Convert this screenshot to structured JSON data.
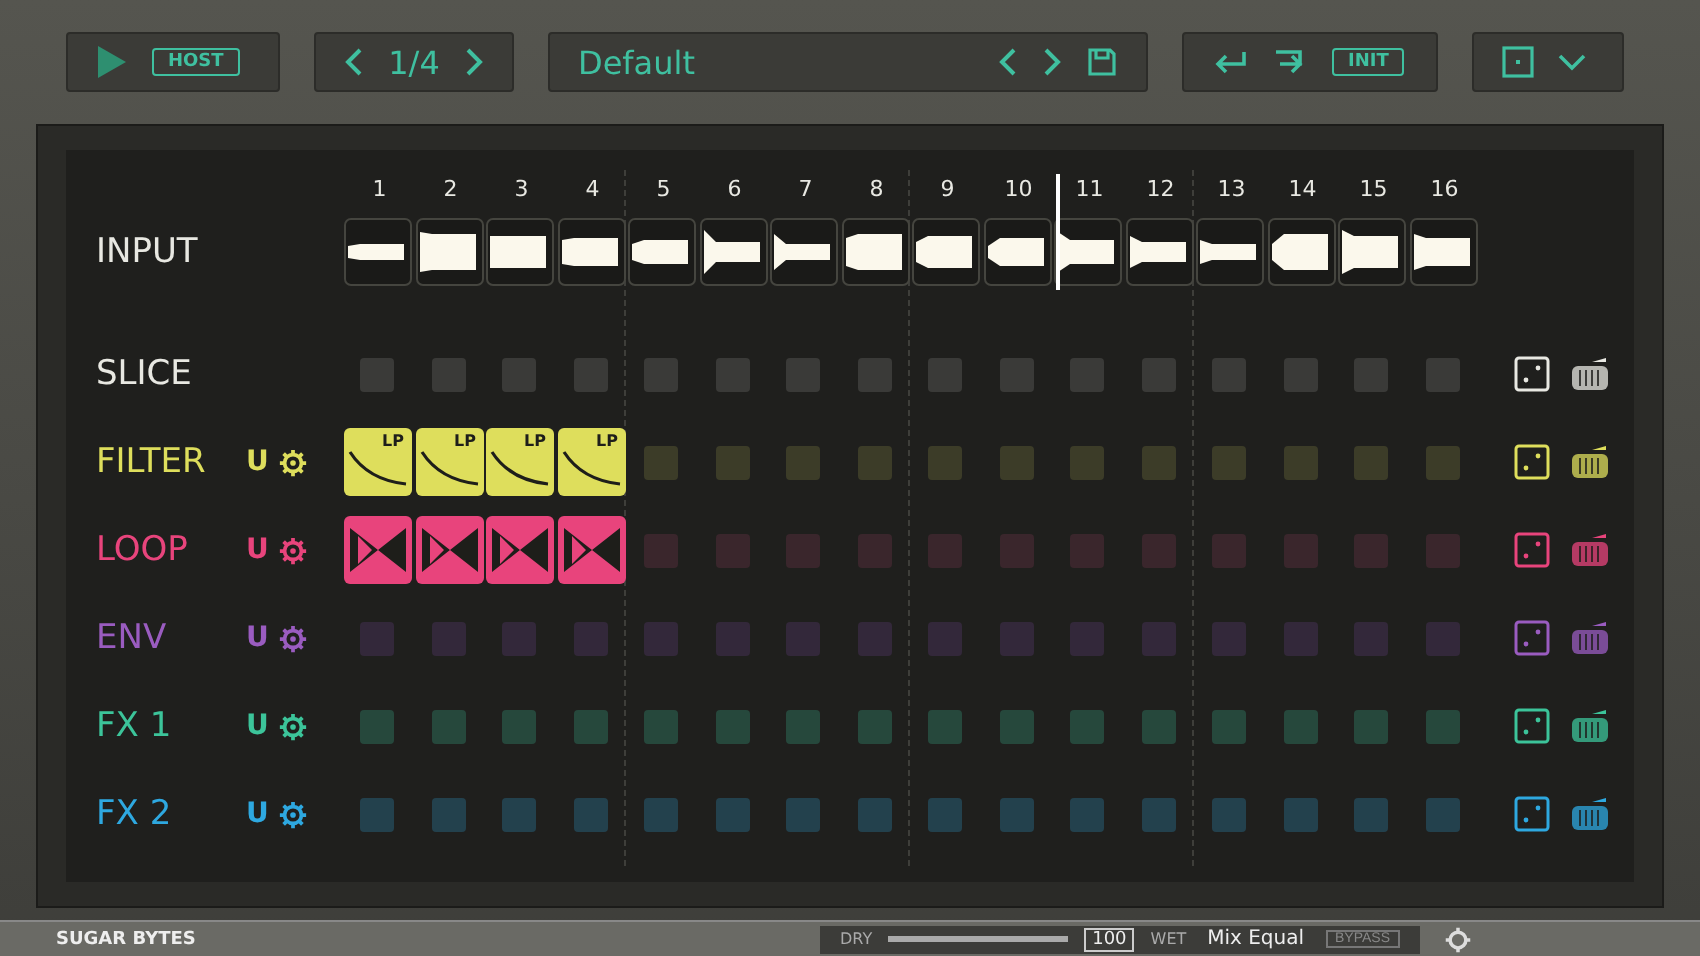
{
  "toolbar": {
    "host": "HOST",
    "page": "1/4",
    "preset": "Default",
    "init": "INIT"
  },
  "columns": [
    {
      "label": "1",
      "selected": false
    },
    {
      "label": "2",
      "selected": false
    },
    {
      "label": "3",
      "selected": false
    },
    {
      "label": "4",
      "selected": false
    },
    {
      "label": "5",
      "selected": false
    },
    {
      "label": "6",
      "selected": false
    },
    {
      "label": "7",
      "selected": false
    },
    {
      "label": "8",
      "selected": false
    },
    {
      "label": "9",
      "selected": false
    },
    {
      "label": "10",
      "selected": false
    },
    {
      "label": "11",
      "selected": true
    },
    {
      "label": "12",
      "selected": false
    },
    {
      "label": "13",
      "selected": false
    },
    {
      "label": "14",
      "selected": false
    },
    {
      "label": "15",
      "selected": false
    },
    {
      "label": "16",
      "selected": false
    }
  ],
  "lanes": [
    {
      "name": "INPUT",
      "kind": "input",
      "color": "#e8e8e2"
    },
    {
      "name": "SLICE",
      "kind": "slice",
      "color": "#e8e8e2",
      "steps": [
        false,
        false,
        false,
        false,
        false,
        false,
        false,
        false,
        false,
        false,
        false,
        false,
        false,
        false,
        false,
        false
      ]
    },
    {
      "name": "FILTER",
      "kind": "filter",
      "color": "#dede5c",
      "unit": "U",
      "step_labels": [
        "LP",
        "LP",
        "LP",
        "LP"
      ],
      "steps": [
        true,
        true,
        true,
        true,
        false,
        false,
        false,
        false,
        false,
        false,
        false,
        false,
        false,
        false,
        false,
        false
      ]
    },
    {
      "name": "LOOP",
      "kind": "loop",
      "color": "#e8447c",
      "unit": "U",
      "steps": [
        true,
        true,
        true,
        true,
        false,
        false,
        false,
        false,
        false,
        false,
        false,
        false,
        false,
        false,
        false,
        false
      ]
    },
    {
      "name": "ENV",
      "kind": "env",
      "color": "#9a5cc0",
      "unit": "U",
      "steps": [
        false,
        false,
        false,
        false,
        false,
        false,
        false,
        false,
        false,
        false,
        false,
        false,
        false,
        false,
        false,
        false
      ]
    },
    {
      "name": "FX 1",
      "kind": "fx",
      "color": "#3cc49a",
      "unit": "U",
      "steps": [
        false,
        false,
        false,
        false,
        false,
        false,
        false,
        false,
        false,
        false,
        false,
        false,
        false,
        false,
        false,
        false
      ]
    },
    {
      "name": "FX 2",
      "kind": "fx",
      "color": "#2ea8e0",
      "unit": "U",
      "steps": [
        false,
        false,
        false,
        false,
        false,
        false,
        false,
        false,
        false,
        false,
        false,
        false,
        false,
        false,
        false,
        false
      ]
    }
  ],
  "footer": {
    "brand": "SUGAR BYTES",
    "dry": "DRY",
    "mix": "100",
    "level": 1,
    "wet": "WET",
    "mode": "Mix Equal",
    "bypass": "BYPASS"
  }
}
